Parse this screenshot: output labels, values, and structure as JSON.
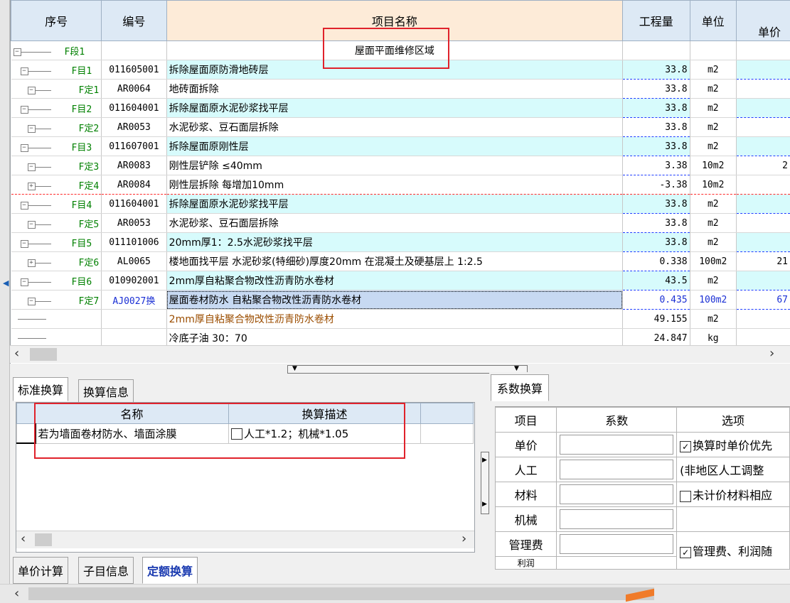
{
  "grid": {
    "headers": [
      "序号",
      "编号",
      "项目名称",
      "工程量",
      "单位",
      "单价"
    ],
    "rows": [
      {
        "seq": "F段1",
        "code": "",
        "name": "屋面平面维修区域",
        "qty": "",
        "unit": "",
        "type": "seg"
      },
      {
        "seq": "F目1",
        "code": "011605001",
        "name": "拆除屋面原防滑地砖层",
        "qty": "33.8",
        "unit": "m2",
        "type": "mu"
      },
      {
        "seq": "F定1",
        "code": "AR0064",
        "name": "地砖面拆除",
        "qty": "33.8",
        "unit": "m2",
        "type": "ding"
      },
      {
        "seq": "F目2",
        "code": "011604001",
        "name": "拆除屋面原水泥砂浆找平层",
        "qty": "33.8",
        "unit": "m2",
        "type": "mu"
      },
      {
        "seq": "F定2",
        "code": "AR0053",
        "name": "水泥砂浆、豆石面层拆除",
        "qty": "33.8",
        "unit": "m2",
        "type": "ding"
      },
      {
        "seq": "F目3",
        "code": "011607001",
        "name": "拆除屋面原刚性层",
        "qty": "33.8",
        "unit": "m2",
        "type": "mu"
      },
      {
        "seq": "F定3",
        "code": "AR0083",
        "name": "刚性层铲除 ≤40mm",
        "qty": "3.38",
        "unit": "10m2",
        "price": "2",
        "type": "ding"
      },
      {
        "seq": "F定4",
        "code": "AR0084",
        "name": "刚性层拆除 每增加10mm",
        "qty": "-3.38",
        "unit": "10m2",
        "type": "ding-plus"
      },
      {
        "seq": "F目4",
        "code": "011604001",
        "name": "拆除屋面原水泥砂浆找平层",
        "qty": "33.8",
        "unit": "m2",
        "type": "mu"
      },
      {
        "seq": "F定5",
        "code": "AR0053",
        "name": "水泥砂浆、豆石面层拆除",
        "qty": "33.8",
        "unit": "m2",
        "type": "ding"
      },
      {
        "seq": "F目5",
        "code": "011101006",
        "name": "20mm厚1：2.5水泥砂浆找平层",
        "qty": "33.8",
        "unit": "m2",
        "type": "mu"
      },
      {
        "seq": "F定6",
        "code": "AL0065",
        "name": "楼地面找平层 水泥砂浆(特细砂)厚度20mm 在混凝土及硬基层上 1:2.5",
        "qty": "0.338",
        "unit": "100m2",
        "price": "21",
        "type": "ding-plus"
      },
      {
        "seq": "F目6",
        "code": "010902001",
        "name": "2mm厚自粘聚合物改性沥青防水卷材",
        "qty": "43.5",
        "unit": "m2",
        "type": "mu"
      },
      {
        "seq": "F定7",
        "code": "AJ0027换",
        "name": "屋面卷材防水 自粘聚合物改性沥青防水卷材",
        "qty": "0.435",
        "unit": "100m2",
        "price": "67",
        "type": "sel"
      },
      {
        "seq": "",
        "code": "",
        "name": "2mm厚自粘聚合物改性沥青防水卷材",
        "qty": "49.155",
        "unit": "m2",
        "type": "mat"
      },
      {
        "seq": "",
        "code": "",
        "name": "冷底子油 30：70",
        "qty": "24.847",
        "unit": "kg",
        "type": "mat2"
      }
    ]
  },
  "left_tabs": {
    "tab1": "标准换算",
    "tab2": "换算信息"
  },
  "sub_grid": {
    "headers": [
      "名称",
      "换算描述"
    ],
    "row_name": "若为墙面卷材防水、墙面涂膜",
    "row_desc": "人工*1.2；机械*1.05"
  },
  "bottom_tabs": {
    "tab1": "单价计算",
    "tab2": "子目信息",
    "tab3": "定额换算"
  },
  "coef_panel": {
    "tab": "系数换算",
    "headers": [
      "项目",
      "系数",
      "选项"
    ],
    "rows": [
      "单价",
      "人工",
      "材料",
      "机械",
      "管理费",
      "利润"
    ],
    "opt1": "换算时单价优先",
    "opt2": "(非地区人工调整",
    "opt3": "未计价材料相应",
    "opt5": "管理费、利润随"
  },
  "colors": {
    "accent_red": "#e0222b",
    "mu_bg": "#d7fbfc",
    "header_bg": "#dde9f5",
    "name_header_bg": "#fdebd8"
  }
}
